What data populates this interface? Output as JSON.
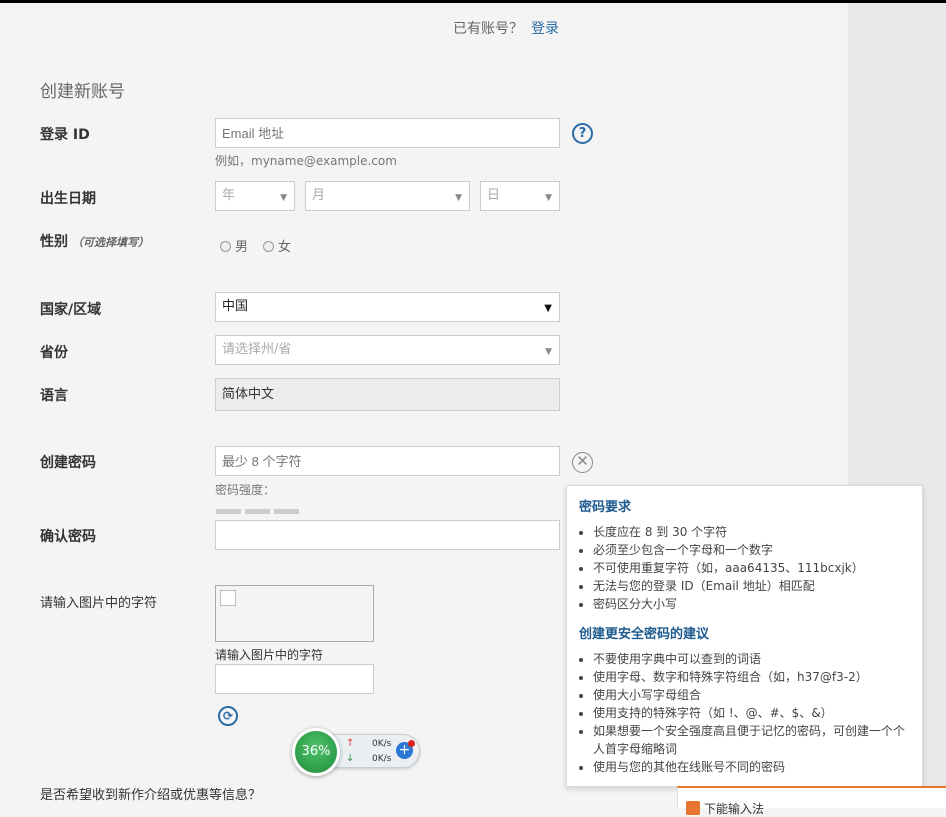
{
  "header": {
    "have_account": "已有账号？",
    "login_link": "登录"
  },
  "form": {
    "section_title": "创建新账号",
    "login_id": {
      "label": "登录 ID",
      "placeholder": "Email 地址",
      "hint": "例如，myname@example.com"
    },
    "birth_date": {
      "label": "出生日期",
      "year": "年",
      "month": "月",
      "day": "日"
    },
    "gender": {
      "label": "性别",
      "optional": "（可选择填写）",
      "male": "男",
      "female": "女"
    },
    "country": {
      "label": "国家/区域",
      "value": "中国"
    },
    "province": {
      "label": "省份",
      "placeholder": "请选择州/省"
    },
    "language": {
      "label": "语言",
      "value": "简体中文"
    },
    "password": {
      "label": "创建密码",
      "placeholder": "最少 8 个字符",
      "strength_label": "密码强度："
    },
    "confirm_password": {
      "label": "确认密码",
      "value": ""
    },
    "captcha": {
      "label": "请输入图片中的字符",
      "input_label": "请输入图片中的字符",
      "value": ""
    },
    "newsletter_question": "是否希望收到新作介绍或优惠等信息？"
  },
  "popup": {
    "requirements_title": "密码要求",
    "requirements": [
      "长度应在 8 到 30 个字符",
      "必须至少包含一个字母和一个数字",
      "不可使用重复字符（如，aaa64135、111bcxjk）",
      "无法与您的登录 ID（Email 地址）相匹配",
      "密码区分大小写"
    ],
    "suggestions_title": "创建更安全密码的建议",
    "suggestions": [
      "不要使用字典中可以查到的词语",
      "使用字母、数字和特殊字符组合（如，h37@f3-2）",
      "使用大小写字母组合",
      "使用支持的特殊字符（如 !、@、#、$、&）",
      "如果想要一个安全强度高且便于记忆的密码，可创建一个个人首字母缩略词",
      "使用与您的其他在线账号不同的密码"
    ]
  },
  "net_widget": {
    "percent": "36%",
    "upload": "0K/s",
    "download": "0K/s"
  },
  "ime_bar": {
    "label": "下能输入法"
  }
}
